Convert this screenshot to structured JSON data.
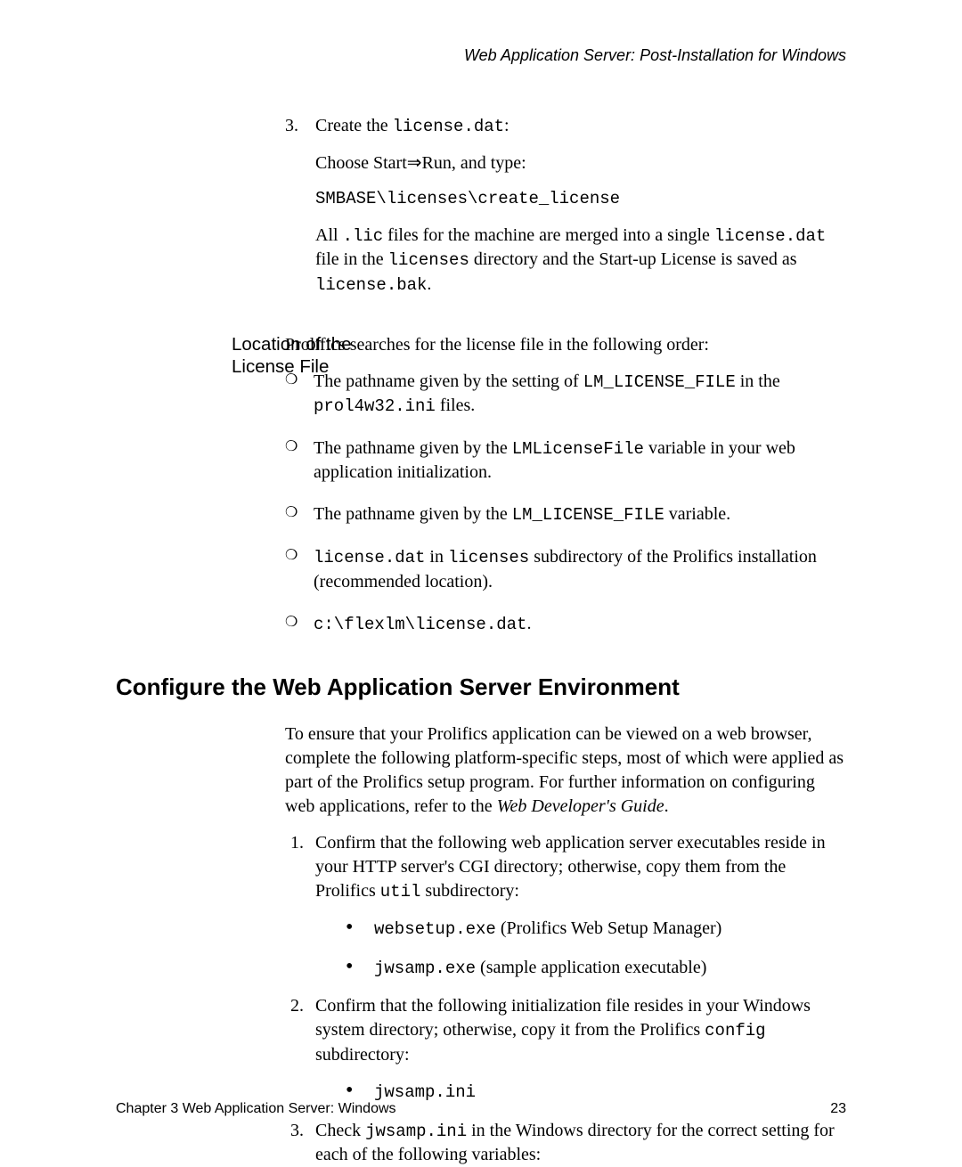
{
  "header": {
    "running": "Web Application Server: Post-Installation for Windows"
  },
  "step3": {
    "num": "3.",
    "lead_pre": "Create the ",
    "lead_code": "license.dat",
    "lead_post": ":",
    "run_line": "Choose Start⇒Run, and type:",
    "cmd": "SMBASE\\licenses\\create_license",
    "merge_1": "All ",
    "merge_c1": ".lic",
    "merge_2": " files for the machine are merged into a single ",
    "merge_c2": "license.dat",
    "merge_3": " file in the ",
    "merge_c3": "licenses",
    "merge_4": " directory and the Start-up License is saved as ",
    "merge_c4": "license.bak",
    "merge_5": "."
  },
  "sidebar": {
    "loc_label": "Location of the License File"
  },
  "loc": {
    "intro": "Prolifics searches for the license file in the following order:",
    "i1a": "The pathname given by the setting of ",
    "i1c1": "LM_LICENSE_FILE",
    "i1b": " in the ",
    "i1c2": "prol4w32.ini",
    "i1d": " files.",
    "i2a": "The pathname given by the ",
    "i2c": "LMLicenseFile",
    "i2b": " variable in your web application initialization.",
    "i3a": "The pathname given by the ",
    "i3c": "LM_LICENSE_FILE",
    "i3b": " variable.",
    "i4c1": "license.dat",
    "i4a": " in ",
    "i4c2": "licenses",
    "i4b": " subdirectory of the Prolifics installation (recommended location).",
    "i5c": "c:\\flexlm\\license.dat",
    "i5a": "."
  },
  "h2": "Configure the Web Application Server Environment",
  "conf": {
    "intro_a": "To ensure that your Prolifics application can be viewed on a web browser, complete the following platform-specific steps, most of which were applied as part of the Prolifics setup program. For further information on configuring web applications, refer to the ",
    "intro_i": "Web Developer's Guide",
    "intro_b": ".",
    "s1a": "Confirm that the following web application server executables reside in your HTTP server's CGI directory; otherwise, copy them from the Prolifics ",
    "s1c": "util",
    "s1b": " subdirectory:",
    "s1_b1c": "websetup.exe",
    "s1_b1t": " (Prolifics Web Setup Manager)",
    "s1_b2c": "jwsamp.exe",
    "s1_b2t": " (sample application executable)",
    "s2a": "Confirm that the following initialization file resides in your Windows system directory; otherwise, copy it from the Prolifics ",
    "s2c": "config",
    "s2b": " subdirectory:",
    "s2_b1c": "jwsamp.ini",
    "s3a": "Check ",
    "s3c": "jwsamp.ini",
    "s3b": " in the Windows directory for the correct setting for each of the following variables:"
  },
  "footer": {
    "left": "Chapter 3    Web Application Server: Windows",
    "page": "23"
  }
}
